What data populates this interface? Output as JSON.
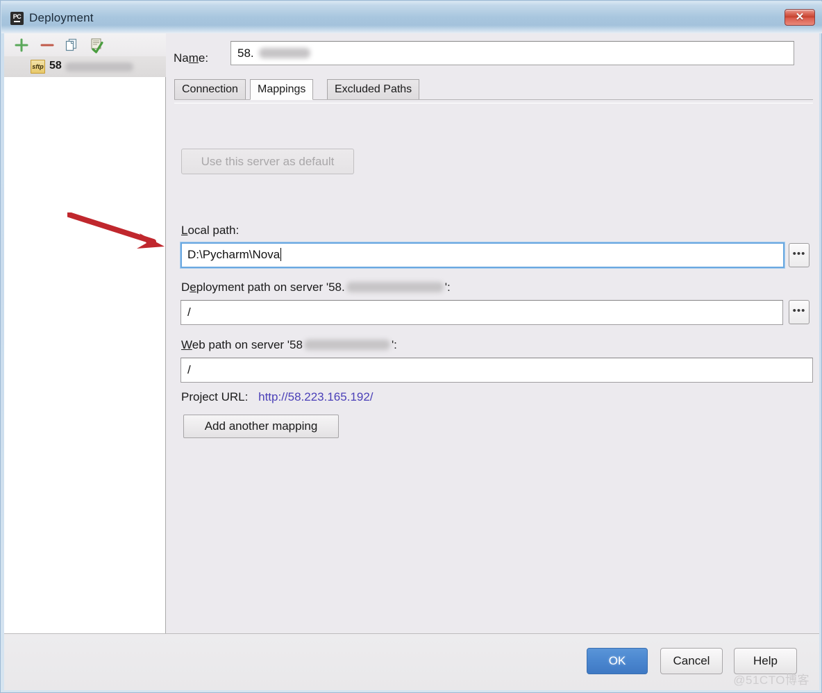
{
  "window": {
    "title": "Deployment",
    "icon": "pycharm-icon",
    "close_label": "✕"
  },
  "sidebar": {
    "toolbar": [
      {
        "name": "add-server-button",
        "glyph": "+",
        "color": "#5aa85a"
      },
      {
        "name": "remove-server-button",
        "glyph": "−",
        "color": "#c05a4a"
      },
      {
        "name": "copy-server-button",
        "glyph": "copy-icon",
        "color": "#6f8fae"
      },
      {
        "name": "validate-connection-button",
        "glyph": "check-icon",
        "color": "#4a9d3f"
      }
    ],
    "servers": [
      {
        "badge": "sftp",
        "label": "58",
        "redacted": true
      }
    ]
  },
  "form": {
    "name_label": "Na",
    "name_label_mnemonic": "m",
    "name_label_rest": "e:",
    "name_value": "58.",
    "name_redacted": true
  },
  "tabs": [
    {
      "id": "connection",
      "label": "Connection",
      "selected": false
    },
    {
      "id": "mappings",
      "label": "Mappings",
      "selected": true
    },
    {
      "id": "excluded",
      "label": "Excluded Paths",
      "selected": false
    }
  ],
  "mappings": {
    "default_server_button": "Use this server as default",
    "default_server_button_disabled": true,
    "local_path": {
      "label_pre": "",
      "label_mnemonic": "L",
      "label_post": "ocal path:",
      "value": "D:\\Pycharm\\Nova",
      "focused": true,
      "browse_label": "•••"
    },
    "deployment_path": {
      "label_pre": "D",
      "label_mnemonic": "e",
      "label_post_a": "ployment path on server '58.",
      "label_post_b": "':",
      "value": "/",
      "redacted": true,
      "browse_label": "•••"
    },
    "web_path": {
      "label_mnemonic": "W",
      "label_post_a": "eb path on server '58",
      "label_post_b": "':",
      "value": "/",
      "redacted": true
    },
    "project_url_label": "Project URL:",
    "project_url_value": "http://58.223.165.192/",
    "project_url_color": "#4b40b8",
    "add_mapping_button": "Add another mapping"
  },
  "footer": {
    "ok_label": "OK",
    "cancel_label": "Cancel",
    "help_label": "Help",
    "watermark": "@51CTO博客"
  },
  "annotation": {
    "arrow_color": "#c0272d",
    "points_to": "deployment-path-input"
  }
}
